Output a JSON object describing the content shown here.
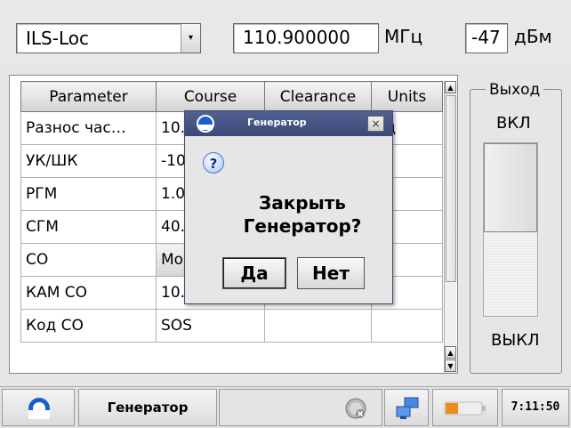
{
  "top": {
    "mode": "ILS-Loc",
    "frequency": "110.900000",
    "frequency_unit": "МГц",
    "power": "-47",
    "power_unit": "дБм"
  },
  "table": {
    "headers": [
      "Parameter",
      "Course",
      "Clearance",
      "Units"
    ],
    "rows": [
      [
        "Разнос час…",
        "10.0",
        "",
        "Гц"
      ],
      [
        "УК/ШК",
        "-10",
        "",
        ""
      ],
      [
        "РГМ",
        "1.0",
        "",
        ""
      ],
      [
        "СГМ",
        "40.0",
        "",
        ""
      ],
      [
        "СО",
        "Mo",
        "",
        ""
      ],
      [
        "КАМ СО",
        "10.0",
        "",
        "%"
      ],
      [
        "Код СО",
        "SOS",
        "",
        ""
      ]
    ]
  },
  "output": {
    "group_label": "Выход",
    "on_label": "ВКЛ",
    "off_label": "ВЫКЛ"
  },
  "dialog": {
    "title": "Генератор",
    "close_glyph": "×",
    "message_line1": "Закрыть",
    "message_line2": "Генератор?",
    "yes_label": "Да",
    "no_label": "Нет",
    "question_glyph": "?"
  },
  "taskbar": {
    "app_title": "Генератор",
    "clock": "7:11:50"
  },
  "colors": {
    "titlebar": "#465486",
    "logo_blue": "#1a5fd0",
    "battery_orange": "#f08a1c"
  }
}
